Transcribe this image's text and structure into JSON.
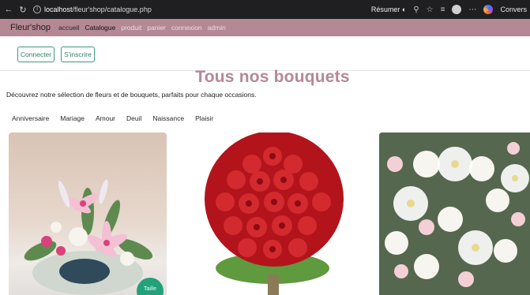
{
  "browser": {
    "url_host": "localhost",
    "url_path": "/fleur'shop/catalogue.php",
    "resume_label": "Résumer",
    "conversation_label": "Convers"
  },
  "navbar": {
    "brand": "Fleur'shop",
    "links": [
      {
        "label": "accueil"
      },
      {
        "label": "Catalogue"
      },
      {
        "label": "produit"
      },
      {
        "label": "panier"
      },
      {
        "label": "connexion"
      },
      {
        "label": "admin"
      }
    ]
  },
  "auth": {
    "login_label": "Connecter",
    "signup_label": "S'inscrire"
  },
  "main": {
    "title": "Tous nos bouquets",
    "intro": "Découvrez notre sélection de fleurs et de bouquets, parfaits pour chaque occasions.",
    "categories": [
      "Anniversaire",
      "Mariage",
      "Amour",
      "Deuil",
      "Naissance",
      "Plaisir"
    ]
  },
  "products": {
    "badge_label": "Taille"
  },
  "colors": {
    "navbar_bg": "#b58895",
    "title_color": "#b58895",
    "button_accent": "#3f9b7b",
    "badge_bg": "#22a17a"
  }
}
